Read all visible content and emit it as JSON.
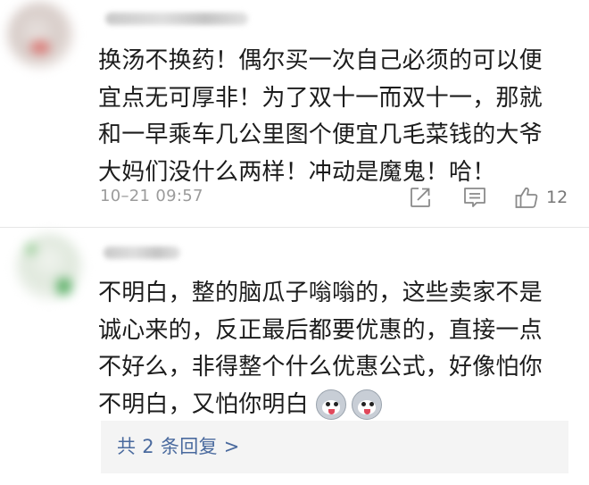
{
  "comments": [
    {
      "lines": [
        "换汤不换药！偶尔买一次自己必须的可以便",
        "宜点无可厚非！为了双十一而双十一，那就",
        "和一早乘车几公里图个便宜几毛菜钱的大爷",
        "大妈们没什么两样！冲动是魔鬼！哈！"
      ],
      "timestamp": "10–21 09:57",
      "actions": {
        "share_icon": "share-icon",
        "comment_icon": "comment-icon",
        "like_icon": "thumbs-up-icon",
        "like_count": "12"
      }
    },
    {
      "lines": [
        "不明白，整的脑瓜子嗡嗡的，这些卖家不是",
        "诚心来的，反正最后都要优惠的，直接一点",
        "不好么，非得整个什么优惠公式，好像怕你",
        "不明白，又怕你明白"
      ],
      "emojis": [
        "husky-emoji",
        "husky-emoji"
      ],
      "replies_link": "共 2 条回复 >"
    }
  ],
  "colors": {
    "text": "#1c1c1c",
    "muted": "#9b9b9b",
    "link": "#4a6a9e",
    "reply_bg": "#f4f4f4",
    "divider": "#e6e6e6"
  }
}
